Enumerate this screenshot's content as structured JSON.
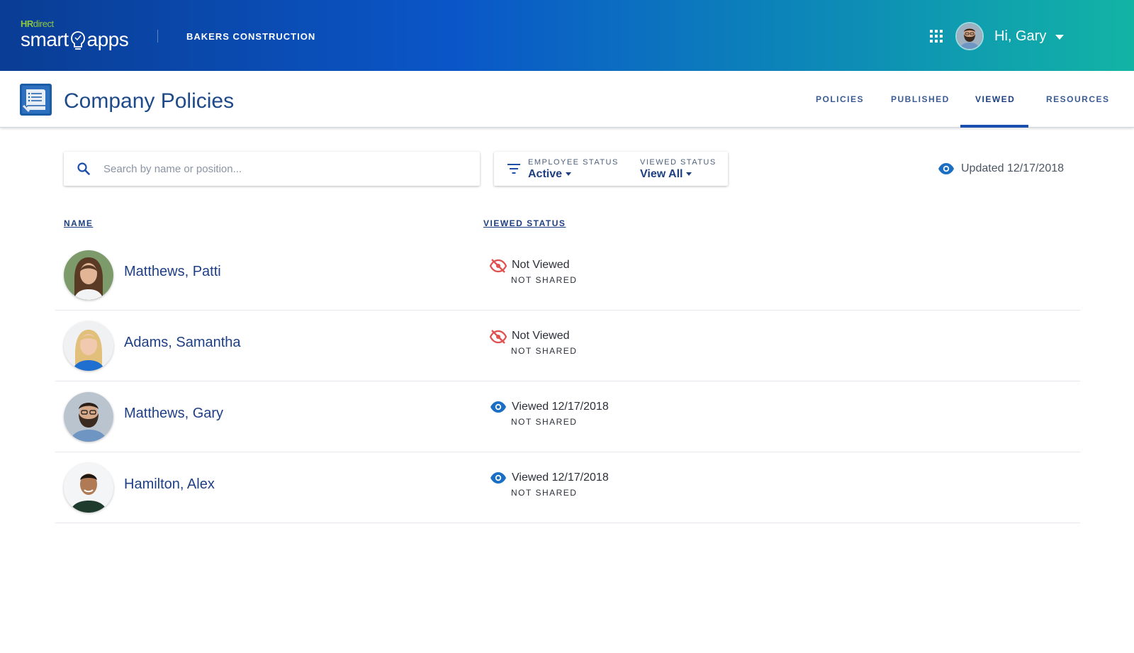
{
  "header": {
    "brand_prefix": "HR",
    "brand_direct": "direct",
    "brand_smart": "smart",
    "brand_apps": "apps",
    "company": "BAKERS CONSTRUCTION",
    "greeting": "Hi, Gary"
  },
  "app": {
    "title": "Company Policies",
    "nav": [
      {
        "label": "POLICIES"
      },
      {
        "label": "PUBLISHED"
      },
      {
        "label": "VIEWED",
        "active": true
      },
      {
        "label": "RESOURCES"
      }
    ]
  },
  "toolbar": {
    "search_placeholder": "Search by name or position...",
    "employee_status_label": "EMPLOYEE STATUS",
    "employee_status_value": "Active",
    "viewed_status_label": "VIEWED STATUS",
    "viewed_status_value": "View All",
    "updated": "Updated 12/17/2018"
  },
  "table": {
    "columns": [
      "NAME",
      "VIEWED STATUS"
    ],
    "rows": [
      {
        "name": "Matthews, Patti",
        "status": "Not Viewed",
        "shared": "NOT SHARED",
        "viewed": false
      },
      {
        "name": "Adams, Samantha",
        "status": "Not Viewed",
        "shared": "NOT SHARED",
        "viewed": false
      },
      {
        "name": "Matthews, Gary",
        "status": "Viewed 12/17/2018",
        "shared": "NOT SHARED",
        "viewed": true
      },
      {
        "name": "Hamilton, Alex",
        "status": "Viewed 12/17/2018",
        "shared": "NOT SHARED",
        "viewed": true
      }
    ]
  },
  "colors": {
    "accent": "#1a4fb0",
    "viewed_icon": "#1a6fc4",
    "not_viewed_icon": "#e0504f"
  }
}
